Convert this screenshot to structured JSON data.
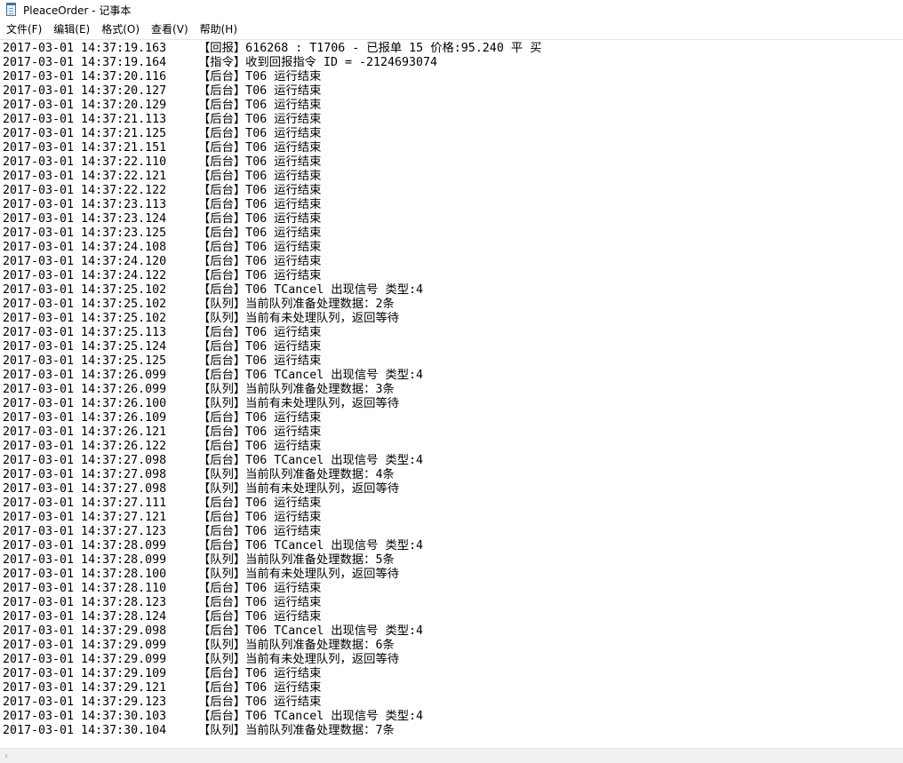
{
  "window": {
    "title": "PleaceOrder - 记事本",
    "app_icon": "notepad-icon"
  },
  "menu": [
    {
      "label": "文件(F)"
    },
    {
      "label": "编辑(E)"
    },
    {
      "label": "格式(O)"
    },
    {
      "label": "查看(V)"
    },
    {
      "label": "帮助(H)"
    }
  ],
  "scrollbar": {
    "left_arrow": "‹"
  },
  "log_lines": [
    {
      "time": "2017-03-01 14:37:19.163",
      "msg": "【回报】616268 : T1706 - 已报单 15 价格:95.240 平 买"
    },
    {
      "time": "2017-03-01 14:37:19.164",
      "msg": "【指令】收到回报指令 ID = -2124693074"
    },
    {
      "time": "2017-03-01 14:37:20.116",
      "msg": "【后台】T06 运行结束"
    },
    {
      "time": "2017-03-01 14:37:20.127",
      "msg": "【后台】T06 运行结束"
    },
    {
      "time": "2017-03-01 14:37:20.129",
      "msg": "【后台】T06 运行结束"
    },
    {
      "time": "2017-03-01 14:37:21.113",
      "msg": "【后台】T06 运行结束"
    },
    {
      "time": "2017-03-01 14:37:21.125",
      "msg": "【后台】T06 运行结束"
    },
    {
      "time": "2017-03-01 14:37:21.151",
      "msg": "【后台】T06 运行结束"
    },
    {
      "time": "2017-03-01 14:37:22.110",
      "msg": "【后台】T06 运行结束"
    },
    {
      "time": "2017-03-01 14:37:22.121",
      "msg": "【后台】T06 运行结束"
    },
    {
      "time": "2017-03-01 14:37:22.122",
      "msg": "【后台】T06 运行结束"
    },
    {
      "time": "2017-03-01 14:37:23.113",
      "msg": "【后台】T06 运行结束"
    },
    {
      "time": "2017-03-01 14:37:23.124",
      "msg": "【后台】T06 运行结束"
    },
    {
      "time": "2017-03-01 14:37:23.125",
      "msg": "【后台】T06 运行结束"
    },
    {
      "time": "2017-03-01 14:37:24.108",
      "msg": "【后台】T06 运行结束"
    },
    {
      "time": "2017-03-01 14:37:24.120",
      "msg": "【后台】T06 运行结束"
    },
    {
      "time": "2017-03-01 14:37:24.122",
      "msg": "【后台】T06 运行结束"
    },
    {
      "time": "2017-03-01 14:37:25.102",
      "msg": "【后台】T06 TCancel 出现信号 类型:4"
    },
    {
      "time": "2017-03-01 14:37:25.102",
      "msg": "【队列】当前队列准备处理数据：2条"
    },
    {
      "time": "2017-03-01 14:37:25.102",
      "msg": "【队列】当前有未处理队列，返回等待"
    },
    {
      "time": "2017-03-01 14:37:25.113",
      "msg": "【后台】T06 运行结束"
    },
    {
      "time": "2017-03-01 14:37:25.124",
      "msg": "【后台】T06 运行结束"
    },
    {
      "time": "2017-03-01 14:37:25.125",
      "msg": "【后台】T06 运行结束"
    },
    {
      "time": "2017-03-01 14:37:26.099",
      "msg": "【后台】T06 TCancel 出现信号 类型:4"
    },
    {
      "time": "2017-03-01 14:37:26.099",
      "msg": "【队列】当前队列准备处理数据：3条"
    },
    {
      "time": "2017-03-01 14:37:26.100",
      "msg": "【队列】当前有未处理队列，返回等待"
    },
    {
      "time": "2017-03-01 14:37:26.109",
      "msg": "【后台】T06 运行结束"
    },
    {
      "time": "2017-03-01 14:37:26.121",
      "msg": "【后台】T06 运行结束"
    },
    {
      "time": "2017-03-01 14:37:26.122",
      "msg": "【后台】T06 运行结束"
    },
    {
      "time": "2017-03-01 14:37:27.098",
      "msg": "【后台】T06 TCancel 出现信号 类型:4"
    },
    {
      "time": "2017-03-01 14:37:27.098",
      "msg": "【队列】当前队列准备处理数据：4条"
    },
    {
      "time": "2017-03-01 14:37:27.098",
      "msg": "【队列】当前有未处理队列，返回等待"
    },
    {
      "time": "2017-03-01 14:37:27.111",
      "msg": "【后台】T06 运行结束"
    },
    {
      "time": "2017-03-01 14:37:27.121",
      "msg": "【后台】T06 运行结束"
    },
    {
      "time": "2017-03-01 14:37:27.123",
      "msg": "【后台】T06 运行结束"
    },
    {
      "time": "2017-03-01 14:37:28.099",
      "msg": "【后台】T06 TCancel 出现信号 类型:4"
    },
    {
      "time": "2017-03-01 14:37:28.099",
      "msg": "【队列】当前队列准备处理数据：5条"
    },
    {
      "time": "2017-03-01 14:37:28.100",
      "msg": "【队列】当前有未处理队列，返回等待"
    },
    {
      "time": "2017-03-01 14:37:28.110",
      "msg": "【后台】T06 运行结束"
    },
    {
      "time": "2017-03-01 14:37:28.123",
      "msg": "【后台】T06 运行结束"
    },
    {
      "time": "2017-03-01 14:37:28.124",
      "msg": "【后台】T06 运行结束"
    },
    {
      "time": "2017-03-01 14:37:29.098",
      "msg": "【后台】T06 TCancel 出现信号 类型:4"
    },
    {
      "time": "2017-03-01 14:37:29.099",
      "msg": "【队列】当前队列准备处理数据：6条"
    },
    {
      "time": "2017-03-01 14:37:29.099",
      "msg": "【队列】当前有未处理队列，返回等待"
    },
    {
      "time": "2017-03-01 14:37:29.109",
      "msg": "【后台】T06 运行结束"
    },
    {
      "time": "2017-03-01 14:37:29.121",
      "msg": "【后台】T06 运行结束"
    },
    {
      "time": "2017-03-01 14:37:29.123",
      "msg": "【后台】T06 运行结束"
    },
    {
      "time": "2017-03-01 14:37:30.103",
      "msg": "【后台】T06 TCancel 出现信号 类型:4"
    },
    {
      "time": "2017-03-01 14:37:30.104",
      "msg": "【队列】当前队列准备处理数据：7条"
    }
  ]
}
